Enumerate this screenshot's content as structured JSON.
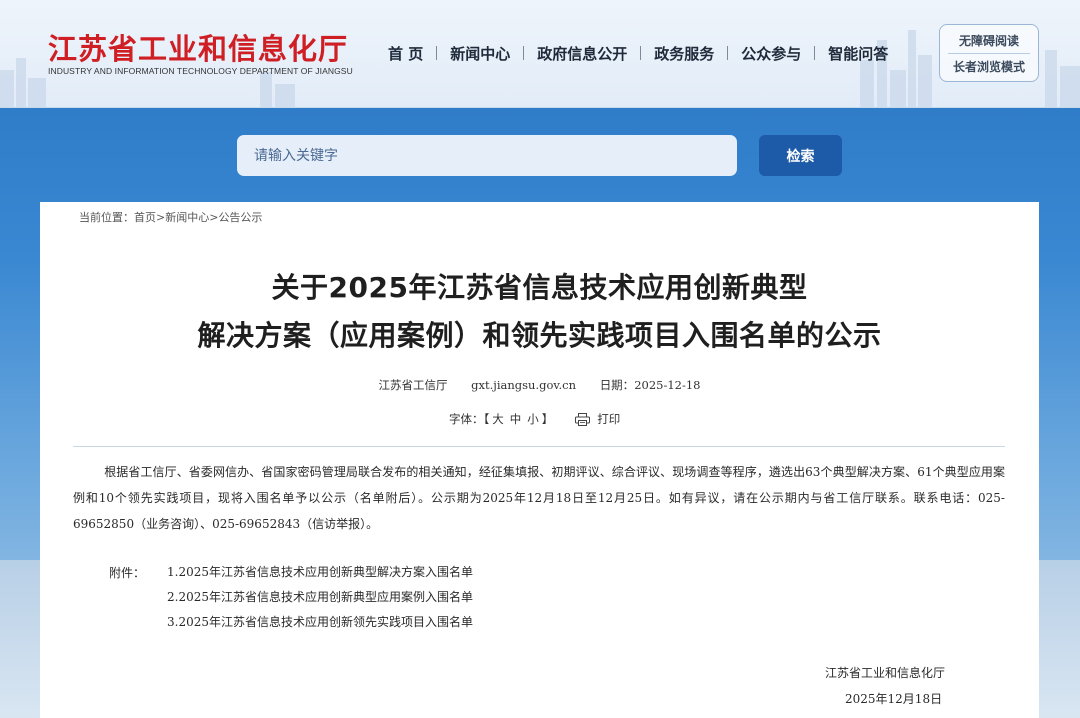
{
  "header": {
    "logo_cn": "江苏省工业和信息化厅",
    "logo_en": "INDUSTRY AND INFORMATION TECHNOLOGY DEPARTMENT OF JIANGSU",
    "nav": [
      "首 页",
      "新闻中心",
      "政府信息公开",
      "政务服务",
      "公众参与",
      "智能问答"
    ],
    "accessibility": {
      "barrier_free": "无障碍阅读",
      "elder_mode": "长者浏览模式"
    }
  },
  "search": {
    "placeholder": "请输入关键字",
    "button": "检索"
  },
  "breadcrumb": {
    "prefix": "当前位置：",
    "items": [
      "首页",
      "新闻中心",
      "公告公示"
    ],
    "separator": ">"
  },
  "article": {
    "title_line1": "关于2025年江苏省信息技术应用创新典型",
    "title_line2": "解决方案（应用案例）和领先实践项目入围名单的公示",
    "source": "江苏省工信厅",
    "site": "gxt.jiangsu.gov.cn",
    "date_label": "日期：",
    "date": "2025-12-18",
    "font_label": "字体：【",
    "font_sizes": [
      "大",
      "中",
      "小"
    ],
    "font_close": "】",
    "print_label": "打印",
    "body": "根据省工信厅、省委网信办、省国家密码管理局联合发布的相关通知，经征集填报、初期评议、综合评议、现场调查等程序，遴选出63个典型解决方案、61个典型应用案例和10个领先实践项目，现将入围名单予以公示（名单附后）。公示期为2025年12月18日至12月25日。如有异议，请在公示期内与省工信厅联系。联系电话：025-69652850（业务咨询）、025-69652843（信访举报）。",
    "attachment_label": "附件：",
    "attachments": [
      "1.2025年江苏省信息技术应用创新典型解决方案入围名单",
      "2.2025年江苏省信息技术应用创新典型应用案例入围名单",
      "3.2025年江苏省信息技术应用创新领先实践项目入围名单"
    ],
    "signature": "江苏省工业和信息化厅",
    "signature_date": "2025年12月18日"
  },
  "colors": {
    "brand_red": "#cf1f24",
    "button_blue": "#1d5aa8",
    "band_blue": "#2f7cc9"
  }
}
